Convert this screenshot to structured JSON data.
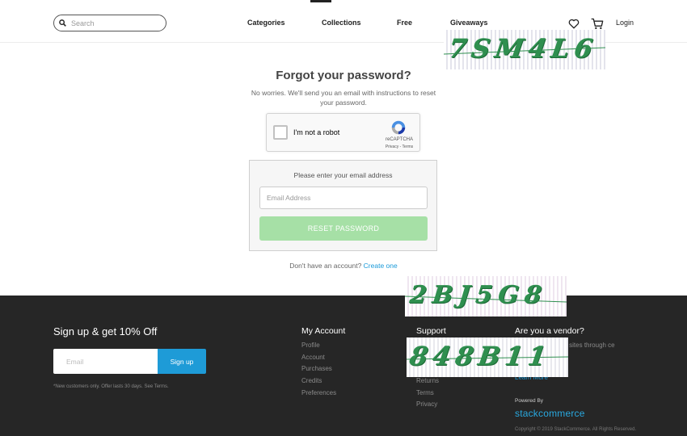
{
  "header": {
    "search_placeholder": "Search",
    "nav": [
      "Categories",
      "Collections",
      "Free",
      "Giveaways"
    ],
    "icons": [
      "search-icon",
      "heart-icon",
      "cart-icon"
    ],
    "login_label": "Login"
  },
  "main": {
    "title": "Forgot your password?",
    "subtitle": "No worries. We'll send you an email with instructions to reset your password.",
    "recaptcha": {
      "label": "I'm not a robot",
      "brand": "reCAPTCHA",
      "terms": "Privacy - Terms"
    },
    "form": {
      "prompt": "Please enter your email address",
      "email_placeholder": "Email Address",
      "reset_label": "RESET PASSWORD"
    },
    "account_text": "Don't have an account?",
    "create_link": "Create one"
  },
  "captchas": {
    "top": "7SM4L6",
    "middle": "2BJ5G8",
    "bottom": "848B11"
  },
  "footer": {
    "signup_title": "Sign up & get 10% Off",
    "email_placeholder": "Email",
    "signup_button": "Sign up",
    "note": "*New customers only. Offer lasts 30 days. See Terms.",
    "my_account": {
      "heading": "My Account",
      "links": [
        "Profile",
        "Account",
        "Purchases",
        "Credits",
        "Preferences"
      ]
    },
    "support": {
      "heading": "Support",
      "links": [
        "Returns",
        "Terms",
        "Privacy"
      ]
    },
    "vendor": {
      "heading": "Are you a vendor?",
      "text": "everage to the her sites through ce network.",
      "learn_more": "Learn More"
    },
    "powered_by": "Powered By",
    "brand": "stackcommerce",
    "copyright": "Copyright © 2019 StackCommerce. All Rights Reserved."
  },
  "colors": {
    "accent": "#1e9bd7",
    "reset_button": "#a6e0a6",
    "footer_bg": "#262626",
    "captcha_text": "#2f8f4f"
  }
}
